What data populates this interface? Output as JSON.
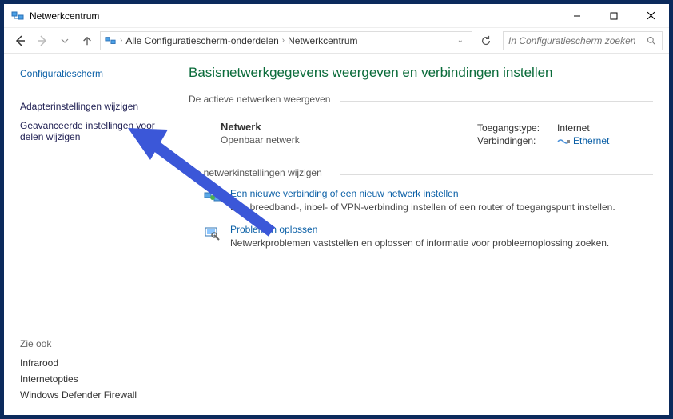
{
  "window": {
    "title": "Netwerkcentrum"
  },
  "breadcrumb": {
    "item1": "Alle Configuratiescherm-onderdelen",
    "item2": "Netwerkcentrum"
  },
  "search": {
    "placeholder": "In Configuratiescherm zoeken"
  },
  "sidebar": {
    "heading": "Configuratiescherm",
    "link1": "Adapterinstellingen wijzigen",
    "link2": "Geavanceerde instellingen voor delen wijzigen",
    "zie_ook_label": "Zie ook",
    "zie_ook": {
      "link1": "Infrarood",
      "link2": "Internetopties",
      "link3": "Windows Defender Firewall"
    }
  },
  "main": {
    "title": "Basisnetwerkgegevens weergeven en verbindingen instellen",
    "active_networks_label": "De actieve netwerken weergeven",
    "network": {
      "name": "Netwerk",
      "type": "Openbaar netwerk",
      "access_label": "Toegangstype:",
      "access_value": "Internet",
      "conn_label": "Verbindingen:",
      "conn_value": "Ethernet"
    },
    "settings_label": "De netwerkinstellingen wijzigen",
    "task1": {
      "title": "Een nieuwe verbinding of een nieuw netwerk instellen",
      "desc": "Een breedband-, inbel- of VPN-verbinding instellen of een router of toegangspunt instellen."
    },
    "task2": {
      "title": "Problemen oplossen",
      "desc": "Netwerkproblemen vaststellen en oplossen of informatie voor probleemoplossing zoeken."
    }
  }
}
